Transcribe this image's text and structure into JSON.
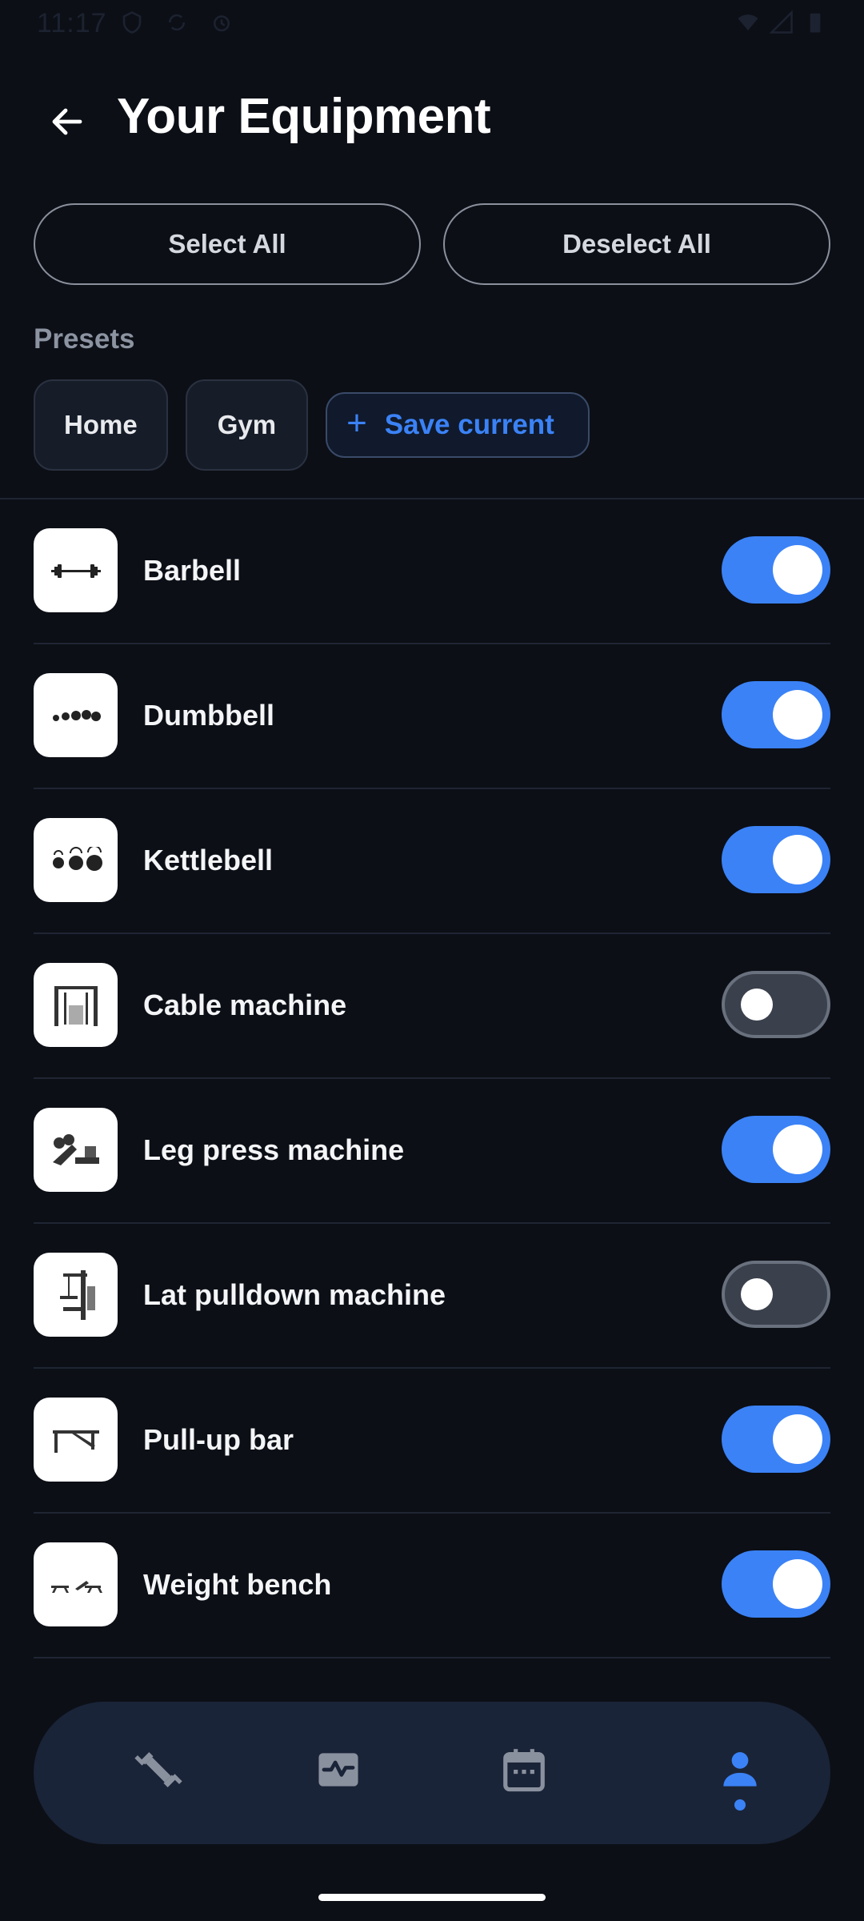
{
  "status_bar": {
    "time": "11:17"
  },
  "header": {
    "title": "Your Equipment"
  },
  "actions": {
    "select_all": "Select All",
    "deselect_all": "Deselect All"
  },
  "presets": {
    "label": "Presets",
    "items": [
      "Home",
      "Gym"
    ],
    "save_label": "Save current"
  },
  "equipment": [
    {
      "name": "Barbell",
      "enabled": true,
      "icon": "barbell-icon"
    },
    {
      "name": "Dumbbell",
      "enabled": true,
      "icon": "dumbbell-icon"
    },
    {
      "name": "Kettlebell",
      "enabled": true,
      "icon": "kettlebell-icon"
    },
    {
      "name": "Cable machine",
      "enabled": false,
      "icon": "cable-machine-icon"
    },
    {
      "name": "Leg press machine",
      "enabled": true,
      "icon": "leg-press-icon"
    },
    {
      "name": "Lat pulldown machine",
      "enabled": false,
      "icon": "lat-pulldown-icon"
    },
    {
      "name": "Pull-up bar",
      "enabled": true,
      "icon": "pull-up-bar-icon"
    },
    {
      "name": "Weight bench",
      "enabled": true,
      "icon": "weight-bench-icon"
    }
  ],
  "nav": {
    "items": [
      "workouts-icon",
      "activity-icon",
      "calendar-icon",
      "profile-icon"
    ],
    "active": "profile-icon"
  },
  "colors": {
    "accent": "#3b82f6",
    "background": "#0c0f16",
    "nav_background": "#1a2438"
  }
}
